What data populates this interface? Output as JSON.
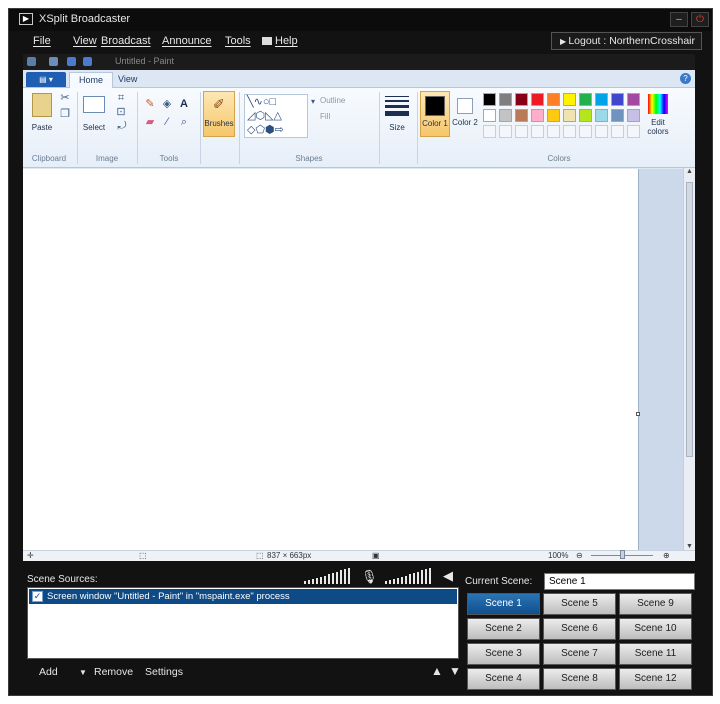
{
  "window": {
    "title": "XSplit Broadcaster"
  },
  "menu": {
    "items": [
      "File",
      "View",
      "Broadcast",
      "Announce",
      "Tools",
      "Help"
    ],
    "logout": "Logout : NorthernCrosshair"
  },
  "paint": {
    "document_title": "Untitled - Paint",
    "tabs": [
      "Home",
      "View"
    ],
    "groups": {
      "clipboard": "Clipboard",
      "image": "Image",
      "tools": "Tools",
      "shapes": "Shapes",
      "colors": "Colors"
    },
    "buttons": {
      "paste": "Paste",
      "select": "Select",
      "brushes": "Brushes",
      "outline": "Outline",
      "fill": "Fill",
      "size": "Size",
      "color1": "Color 1",
      "color2": "Color 2",
      "edit_colors": "Edit colors"
    },
    "palette_row1": [
      "#000000",
      "#7f7f7f",
      "#880015",
      "#ed1c24",
      "#ff7f27",
      "#fff200",
      "#22b14c",
      "#00a2e8",
      "#3f48cc",
      "#a349a4"
    ],
    "palette_row2": [
      "#ffffff",
      "#c3c3c3",
      "#b97a57",
      "#ffaec9",
      "#ffc90e",
      "#efe4b0",
      "#b5e61d",
      "#99d9ea",
      "#7092be",
      "#c8bfe7"
    ],
    "status": {
      "dimensions": "837 × 663px",
      "zoom": "100%"
    }
  },
  "sources": {
    "label": "Scene Sources:",
    "items": [
      {
        "text": "Screen window \"Untitled - Paint\" in \"mspaint.exe\" process",
        "checked": true
      }
    ],
    "toolbar": {
      "add": "Add",
      "remove": "Remove",
      "settings": "Settings"
    }
  },
  "scenes": {
    "current_label": "Current Scene:",
    "current_value": "Scene 1",
    "list": [
      "Scene 1",
      "Scene 5",
      "Scene 9",
      "Scene 2",
      "Scene 6",
      "Scene 10",
      "Scene 3",
      "Scene 7",
      "Scene 11",
      "Scene 4",
      "Scene 8",
      "Scene 12"
    ]
  }
}
